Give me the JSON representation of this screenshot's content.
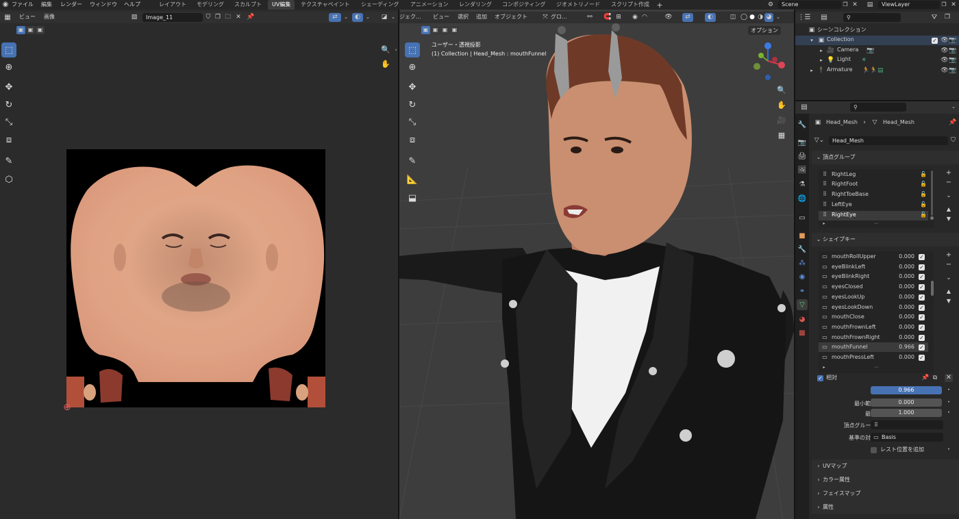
{
  "menubar": {
    "items": [
      "ファイル",
      "編集",
      "レンダー",
      "ウィンドウ",
      "ヘルプ"
    ],
    "workspaces": [
      "レイアウト",
      "モデリング",
      "スカルプト",
      "UV編集",
      "テクスチャペイント",
      "シェーディング",
      "アニメーション",
      "レンダリング",
      "コンポジティング",
      "ジオメトリノード",
      "スクリプト作成"
    ],
    "scene": "Scene",
    "view_layer": "ViewLayer"
  },
  "uv_editor": {
    "menus": [
      "ビュー",
      "画像"
    ],
    "image_name": "Image_11"
  },
  "viewport": {
    "menus": [
      "ジェク...",
      "ビュー",
      "選択",
      "追加",
      "オブジェクト"
    ],
    "transform": "グロ...",
    "options": "オプション",
    "view_label": "ユーザー・透視投影",
    "object_info": "(1) Collection | Head_Mesh : mouthFunnel"
  },
  "outliner": {
    "scene_collection": "シーンコレクション",
    "items": [
      {
        "name": "Collection",
        "indent": 0
      },
      {
        "name": "Camera",
        "indent": 1
      },
      {
        "name": "Light",
        "indent": 1
      },
      {
        "name": "Armature",
        "indent": 0
      }
    ]
  },
  "properties": {
    "breadcrumb_left": "Head_Mesh",
    "breadcrumb_right": "Head_Mesh",
    "data_name": "Head_Mesh",
    "vertex_groups_title": "頂点グループ",
    "vertex_groups": [
      "RightLeg",
      "RightFoot",
      "RightToeBase",
      "LeftEye",
      "RightEye"
    ],
    "shape_keys_title": "シェイプキー",
    "shape_keys": [
      {
        "name": "mouthRollUpper",
        "value": "0.000"
      },
      {
        "name": "eyeBlinkLeft",
        "value": "0.000"
      },
      {
        "name": "eyeBlinkRight",
        "value": "0.000"
      },
      {
        "name": "eyesClosed",
        "value": "0.000"
      },
      {
        "name": "eyesLookUp",
        "value": "0.000"
      },
      {
        "name": "eyesLookDown",
        "value": "0.000"
      },
      {
        "name": "mouthClose",
        "value": "0.000"
      },
      {
        "name": "mouthFrownLeft",
        "value": "0.000"
      },
      {
        "name": "mouthFrownRight",
        "value": "0.000"
      },
      {
        "name": "mouthFunnel",
        "value": "0.966"
      },
      {
        "name": "mouthPressLeft",
        "value": "0.000"
      }
    ],
    "relative_label": "相対",
    "value_label": "値",
    "value": "0.966",
    "min_label": "最小範囲",
    "min": "0.000",
    "max_label": "最大",
    "max": "1.000",
    "vgroup_label": "頂点グループ",
    "relative_to_label": "基準の対象",
    "relative_to": "Basis",
    "rest_label": "レスト位置を追加",
    "panels": [
      "UVマップ",
      "カラー属性",
      "フェイスマップ",
      "属性"
    ]
  },
  "colors": {
    "accent": "#4772b3",
    "bg": "#1d1d1d",
    "header": "#303030",
    "panel": "#2b2b2b"
  }
}
